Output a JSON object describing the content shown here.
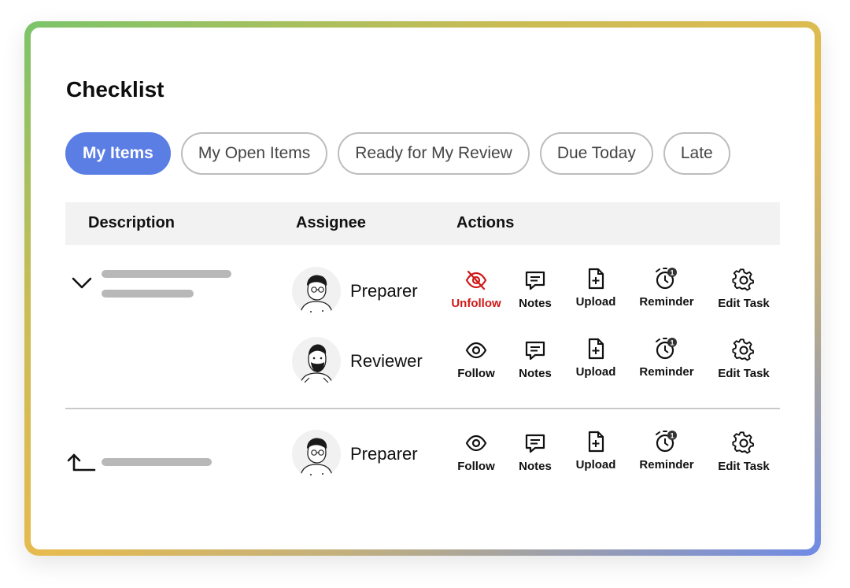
{
  "panel": {
    "title": "Checklist"
  },
  "tabs": [
    {
      "label": "My Items",
      "active": true
    },
    {
      "label": "My Open Items",
      "active": false
    },
    {
      "label": "Ready for My Review",
      "active": false
    },
    {
      "label": "Due Today",
      "active": false
    },
    {
      "label": "Late",
      "active": false
    }
  ],
  "table": {
    "headers": {
      "description": "Description",
      "assignee": "Assignee",
      "actions": "Actions"
    }
  },
  "items": [
    {
      "expanded": true,
      "assignees": [
        {
          "role": "Preparer",
          "avatar_icon": "person-glasses-avatar-icon",
          "actions": {
            "follow": "Unfollow",
            "notes": "Notes",
            "upload": "Upload",
            "reminder": "Reminder",
            "reminder_badge": "1",
            "edit": "Edit Task"
          }
        },
        {
          "role": "Reviewer",
          "avatar_icon": "person-beard-avatar-icon",
          "actions": {
            "follow": "Follow",
            "notes": "Notes",
            "upload": "Upload",
            "reminder": "Reminder",
            "reminder_badge": "1",
            "edit": "Edit Task"
          }
        }
      ]
    },
    {
      "expanded": false,
      "assignees": [
        {
          "role": "Preparer",
          "avatar_icon": "person-glasses-avatar-icon",
          "actions": {
            "follow": "Follow",
            "notes": "Notes",
            "upload": "Upload",
            "reminder": "Reminder",
            "reminder_badge": "1",
            "edit": "Edit Task"
          }
        }
      ]
    }
  ],
  "colors": {
    "accent": "#5b7ee5",
    "unfollow": "#d01818",
    "placeholder_bar": "#b8b8b8",
    "header_bg": "#f2f2f2"
  }
}
